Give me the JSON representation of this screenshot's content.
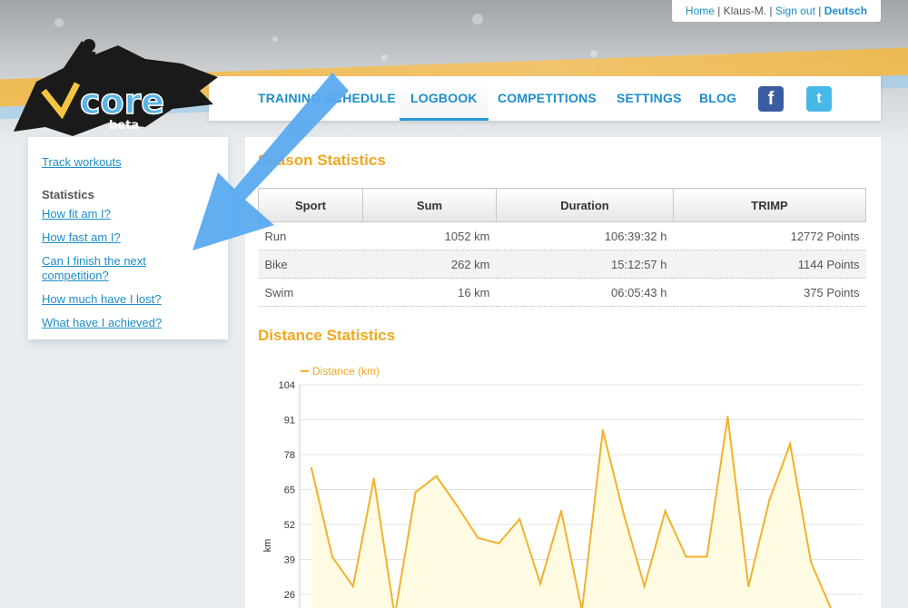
{
  "toplinks": {
    "home": "Home",
    "user": "Klaus-M.",
    "signout": "Sign out",
    "language": "Deutsch"
  },
  "logo": {
    "text": "core",
    "sub": "beta"
  },
  "nav": {
    "items": [
      "TRAINING SCHEDULE",
      "LOGBOOK",
      "COMPETITIONS",
      "SETTINGS",
      "BLOG"
    ],
    "active": "LOGBOOK",
    "facebook_icon": "f",
    "twitter_icon": "t"
  },
  "sidebar": {
    "track": "Track workouts",
    "heading": "Statistics",
    "links": [
      "How fit am I?",
      "How fast am I?",
      "Can I finish the next competition?",
      "How much have I lost?",
      "What have I achieved?"
    ]
  },
  "season": {
    "title": "Season Statistics",
    "headers": [
      "Sport",
      "Sum",
      "Duration",
      "TRIMP"
    ],
    "rows": [
      [
        "Run",
        "1052 km",
        "106:39:32 h",
        "12772 Points"
      ],
      [
        "Bike",
        "262 km",
        "15:12:57 h",
        "1144 Points"
      ],
      [
        "Swim",
        "16 km",
        "06:05:43 h",
        "375 Points"
      ]
    ]
  },
  "distance": {
    "title": "Distance Statistics"
  },
  "chart_data": {
    "type": "area",
    "ylabel": "km",
    "legend": "Distance (km)",
    "yticks": [
      26,
      39,
      52,
      65,
      78,
      91,
      104
    ],
    "ylim": [
      13,
      104
    ],
    "values": [
      73,
      40,
      29,
      69,
      18,
      64,
      70,
      59,
      47,
      45,
      54,
      30,
      57,
      20,
      87,
      56,
      29,
      57,
      40,
      40,
      92,
      29,
      61,
      82,
      38,
      20
    ],
    "line_color": "#f0b22d",
    "fill_color": "#fffbe3"
  },
  "colors": {
    "accent": "#f0a81e",
    "link": "#1c8ec8",
    "arrow": "#5aaaf0"
  }
}
